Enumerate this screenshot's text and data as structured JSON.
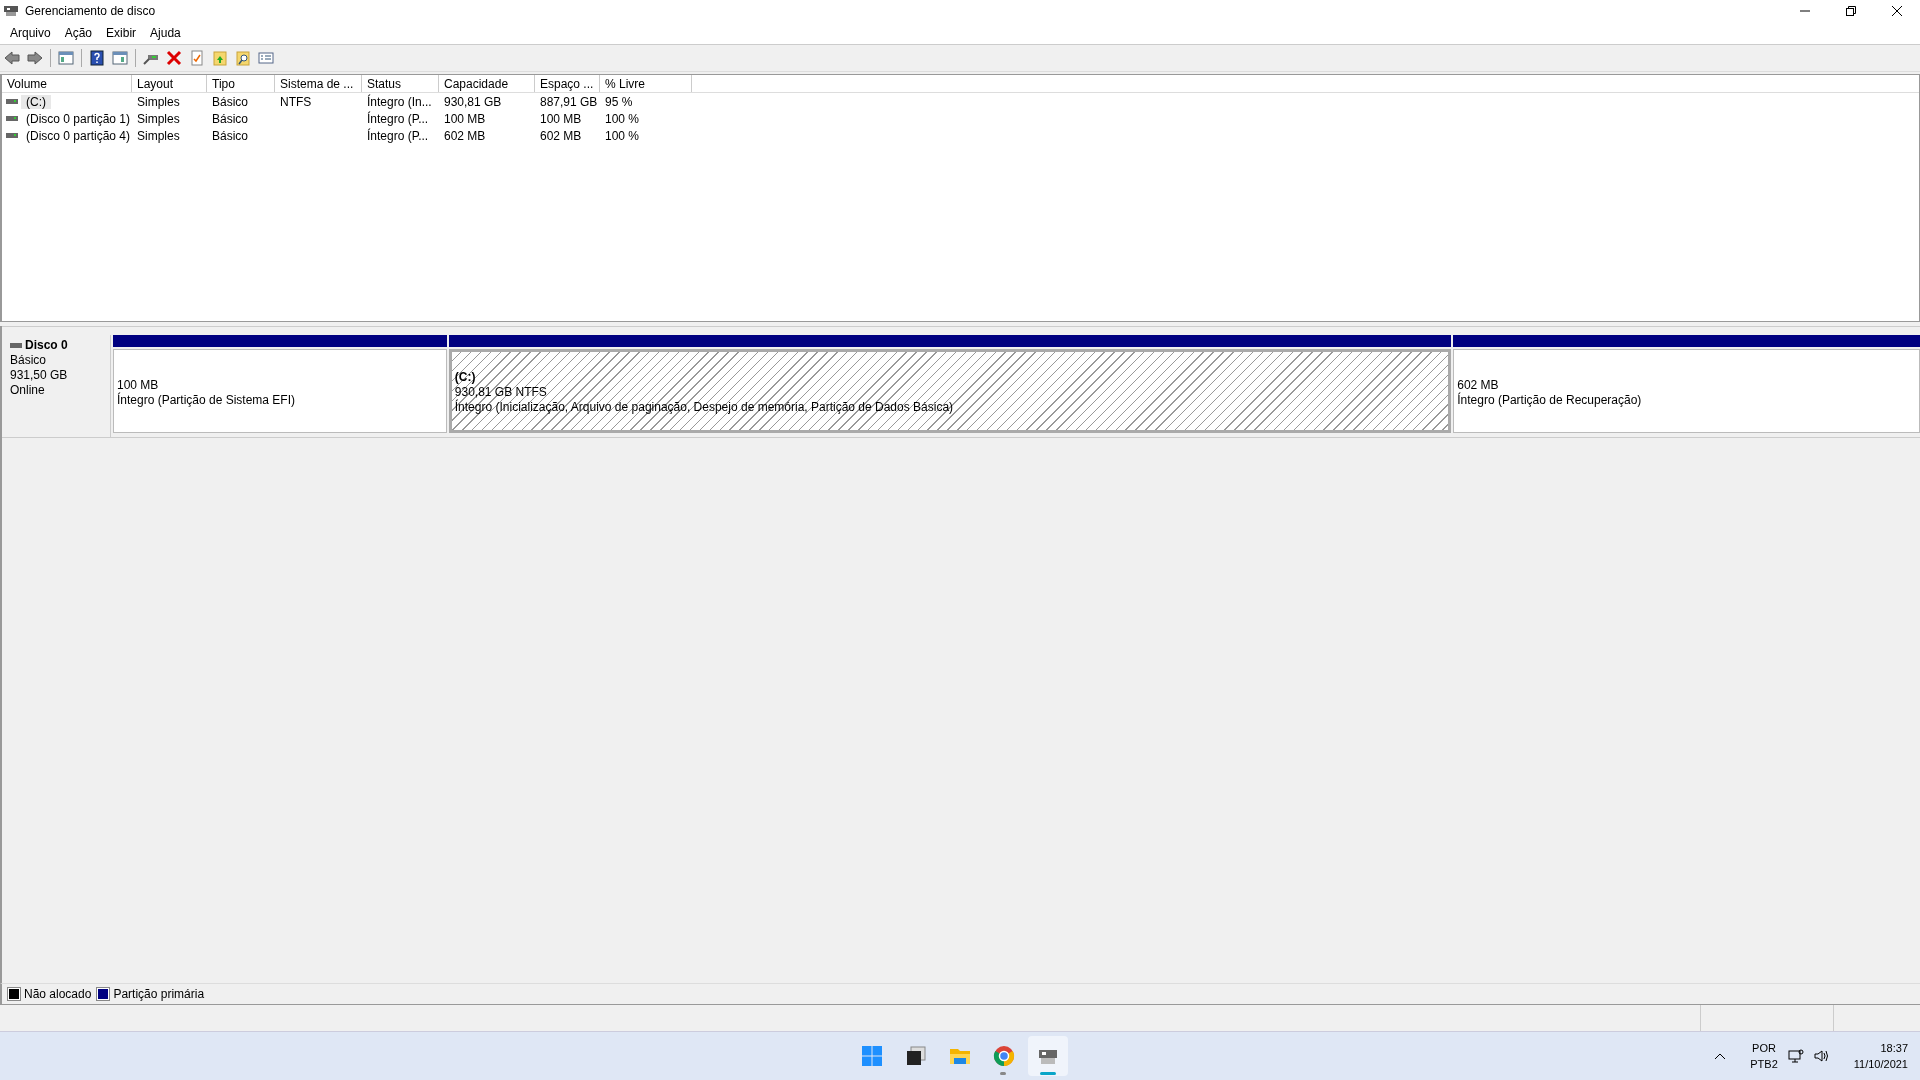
{
  "window": {
    "title": "Gerenciamento de disco"
  },
  "menu": [
    "Arquivo",
    "Ação",
    "Exibir",
    "Ajuda"
  ],
  "volumes": {
    "columns": [
      "Volume",
      "Layout",
      "Tipo",
      "Sistema de ...",
      "Status",
      "Capacidade",
      "Espaço ...",
      "% Livre"
    ],
    "rows": [
      {
        "selected": true,
        "cells": [
          "(C:)",
          "Simples",
          "Básico",
          "NTFS",
          "Íntegro (In...",
          "930,81 GB",
          "887,91 GB",
          "95 %"
        ]
      },
      {
        "selected": false,
        "cells": [
          "(Disco 0 partição 1)",
          "Simples",
          "Básico",
          "",
          "Íntegro (P...",
          "100 MB",
          "100 MB",
          "100 %"
        ]
      },
      {
        "selected": false,
        "cells": [
          "(Disco 0 partição 4)",
          "Simples",
          "Básico",
          "",
          "Íntegro (P...",
          "602 MB",
          "602 MB",
          "100 %"
        ]
      }
    ]
  },
  "disks": [
    {
      "name": "Disco 0",
      "type": "Básico",
      "size": "931,50 GB",
      "status": "Online",
      "partitions": [
        {
          "kind": "primary",
          "selected": false,
          "size": "100 MB",
          "status": "Íntegro (Partição de Sistema EFI)"
        },
        {
          "kind": "primary",
          "selected": true,
          "label": "(C:)",
          "size": "930,81 GB NTFS",
          "status": "Íntegro (Inicialização, Arquivo de paginação, Despejo de memória, Partição de Dados Básica)"
        },
        {
          "kind": "primary",
          "selected": false,
          "size": "602 MB",
          "status": "Íntegro (Partição de Recuperação)"
        }
      ]
    }
  ],
  "legend": [
    {
      "label": "Não alocado",
      "color": "#000000"
    },
    {
      "label": "Partição primária",
      "color": "#000080"
    }
  ],
  "taskbar": {
    "apps": [
      {
        "kind": "start",
        "running": false,
        "active": false
      },
      {
        "kind": "task-view",
        "running": false,
        "active": false
      },
      {
        "kind": "explorer",
        "running": false,
        "active": false
      },
      {
        "kind": "browser",
        "running": true,
        "active": false
      },
      {
        "kind": "disk-tool",
        "running": true,
        "active": true
      }
    ],
    "language": "POR",
    "layout": "PTB2",
    "time": "18:37",
    "date": "11/10/2021"
  }
}
